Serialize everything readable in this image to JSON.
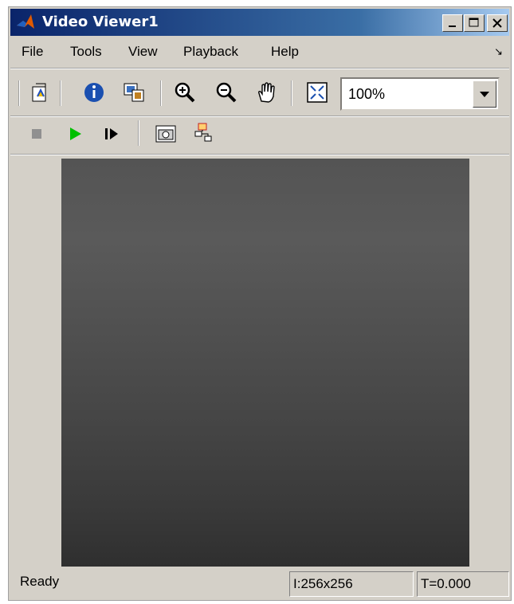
{
  "window": {
    "title": "Video Viewer1",
    "controls": [
      "minimize-icon",
      "maximize-icon",
      "close-icon"
    ]
  },
  "menu": {
    "items": [
      "File",
      "Tools",
      "View",
      "Playback",
      "Help"
    ]
  },
  "toolbar1": {
    "icons": [
      "open-icon",
      "info-icon",
      "copy-image-icon",
      "zoom-in-icon",
      "zoom-out-icon",
      "pan-hand-icon",
      "fit-to-window-icon"
    ],
    "zoom_value": "100%"
  },
  "toolbar2": {
    "icons": [
      "stop-icon",
      "play-icon",
      "step-forward-icon",
      "snapshot-camera-icon",
      "highlight-block-icon"
    ]
  },
  "status": {
    "text": "Ready",
    "image_size": "I:256x256",
    "time": "T=0.000"
  },
  "colors": {
    "title_start": "#0a246a",
    "title_end": "#a6caf0",
    "play_green": "#00c000",
    "window_bg": "#d4d0c8"
  }
}
